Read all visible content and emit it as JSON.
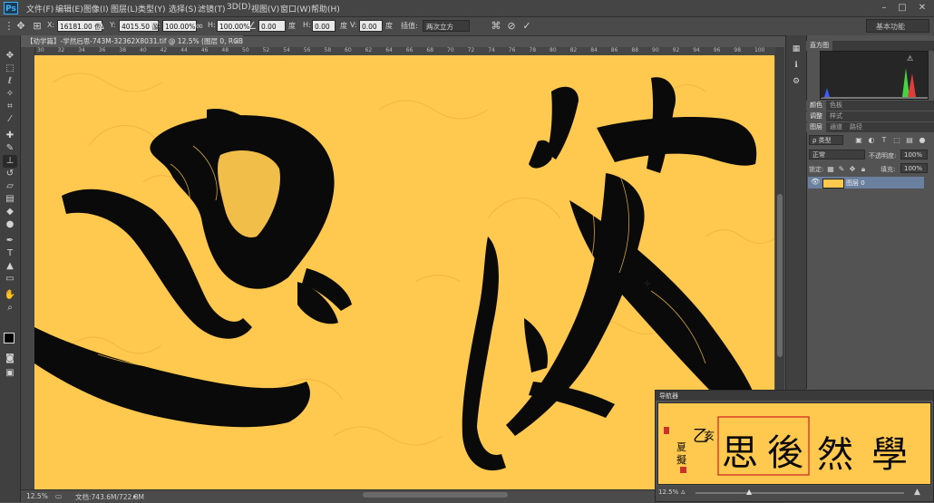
{
  "app": {
    "logo": "Ps"
  },
  "menu": [
    "文件(F)",
    "编辑(E)",
    "图像(I)",
    "图层(L)",
    "类型(Y)",
    "选择(S)",
    "滤镜(T)",
    "3D(D)",
    "视图(V)",
    "窗口(W)",
    "帮助(H)"
  ],
  "options": {
    "x_label": "X:",
    "x_value": "16181.00 像",
    "y_label": "Y:",
    "y_value": "4015.50 像",
    "w_label": "W:",
    "w_value": "100.00%",
    "h_label": "H:",
    "h_value": "100.00%",
    "angle_value": "0.00",
    "deg": "度",
    "hskew_label": "H:",
    "hskew_value": "0.00",
    "vskew_label": "V:",
    "vskew_value": "0.00",
    "interp_label": "插值:",
    "interp_value": "两次立方",
    "workspace": "基本功能"
  },
  "document": {
    "tab_title": "【劝学篇】-学然后思-743M-32362X8031.tif @ 12.5% (图层 0, RGB/8) *",
    "close": "×",
    "zoom": "12.5%",
    "doc_size": "文档:743.6M/722.8M",
    "ruler_ticks": [
      "30",
      "32",
      "34",
      "36",
      "38",
      "40",
      "42",
      "44",
      "46",
      "48",
      "50",
      "52",
      "54",
      "56",
      "58",
      "60",
      "62",
      "64",
      "66",
      "68",
      "70",
      "72",
      "74",
      "76",
      "78",
      "80",
      "82",
      "84",
      "86",
      "88",
      "90",
      "92",
      "94",
      "96",
      "98",
      "100"
    ]
  },
  "panels": {
    "histogram_tabs": [
      "直方图"
    ],
    "color_tabs": [
      "颜色",
      "色板"
    ],
    "adjust_tabs": [
      "调整",
      "样式"
    ],
    "layers_tabs": [
      "图层",
      "通道",
      "路径"
    ],
    "kind_filter": "ρ 类型",
    "blend_mode": "正常",
    "opacity_label": "不透明度:",
    "opacity_value": "100%",
    "lock_label": "锁定:",
    "fill_label": "填充:",
    "fill_value": "100%",
    "layer_name": "图层 0"
  },
  "navigator": {
    "title": "导航器",
    "zoom": "12.5%"
  },
  "colors": {
    "canvas_bg": "#ffc84e",
    "ink": "#0a0a0a",
    "accent_frame": "#cc2222"
  }
}
